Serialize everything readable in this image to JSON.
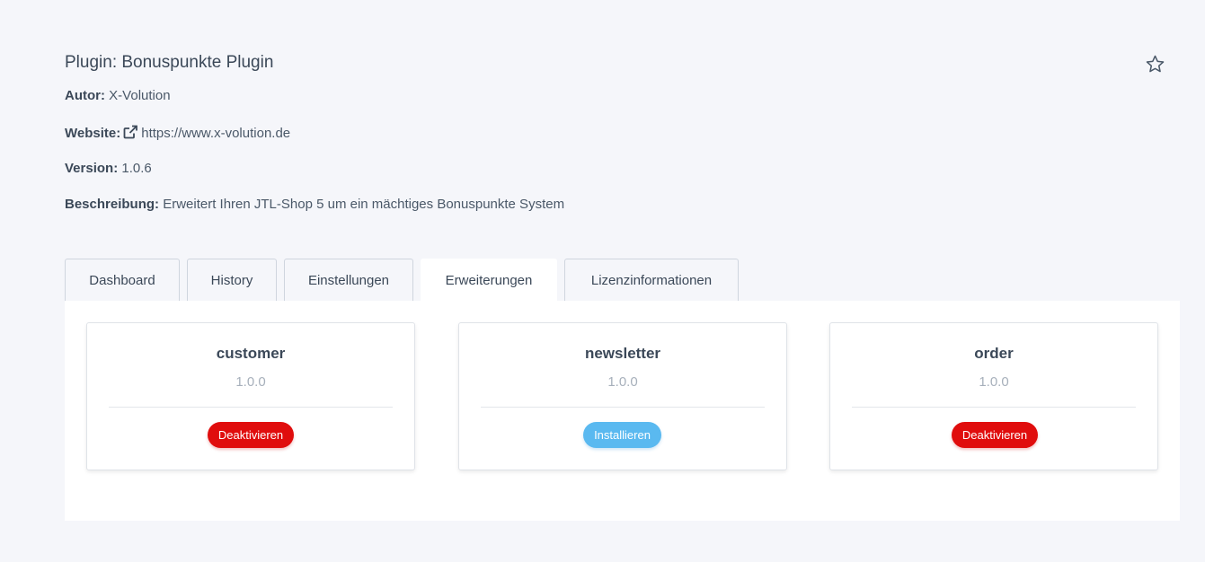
{
  "plugin": {
    "title": "Plugin: Bonuspunkte Plugin",
    "author_label": "Autor:",
    "author": "X-Volution",
    "website_label": "Website:",
    "website": "https://www.x-volution.de",
    "version_label": "Version:",
    "version": "1.0.6",
    "description_label": "Beschreibung:",
    "description": "Erweitert Ihren JTL-Shop 5 um ein mächtiges Bonuspunkte System"
  },
  "icons": {
    "favorite": "star-icon",
    "external_link": "external-link-icon"
  },
  "tabs": [
    {
      "label": "Dashboard",
      "active": false
    },
    {
      "label": "History",
      "active": false
    },
    {
      "label": "Einstellungen",
      "active": false
    },
    {
      "label": "Erweiterungen",
      "active": true
    },
    {
      "label": "Lizenzinformationen",
      "active": false
    }
  ],
  "extensions": [
    {
      "name": "customer",
      "version": "1.0.0",
      "action": "Deaktivieren",
      "action_color": "#e00d0d"
    },
    {
      "name": "newsletter",
      "version": "1.0.0",
      "action": "Installieren",
      "action_color": "#5ab9f0"
    },
    {
      "name": "order",
      "version": "1.0.0",
      "action": "Deaktivieren",
      "action_color": "#e00d0d"
    }
  ]
}
